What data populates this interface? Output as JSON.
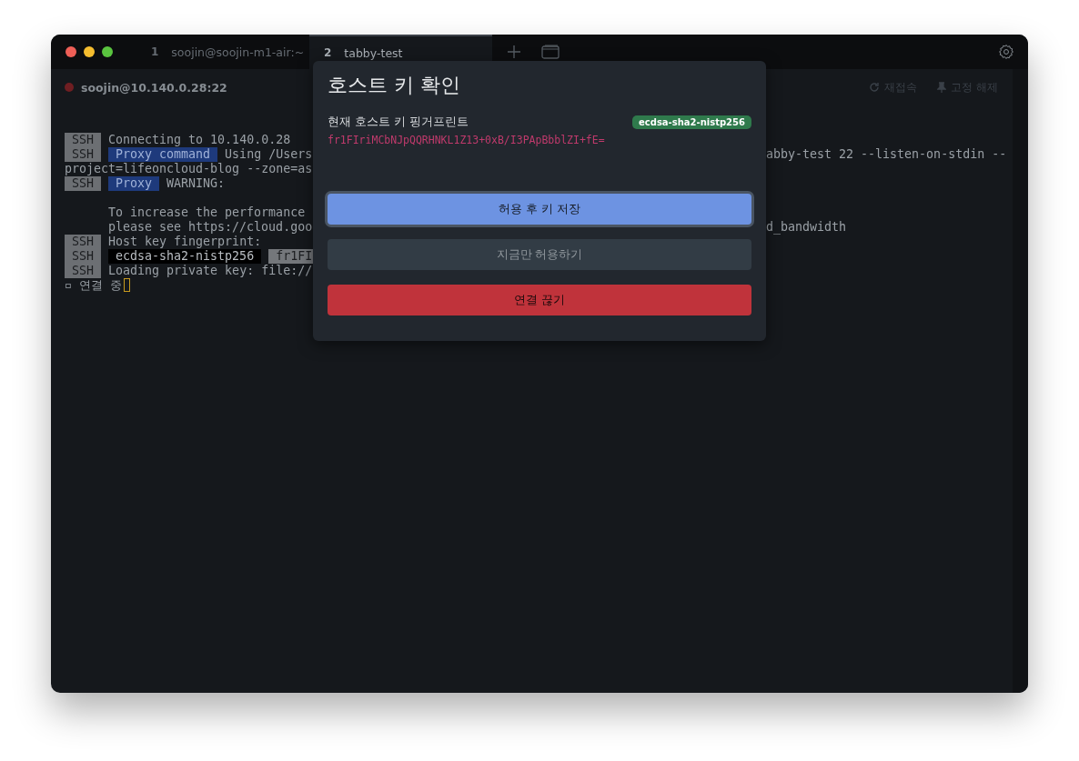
{
  "tabs": [
    {
      "number": "1",
      "label": "soojin@soojin-m1-air:~",
      "selected": false
    },
    {
      "number": "2",
      "label": "tabby-test",
      "selected": true
    }
  ],
  "header": {
    "connection": "soojin@10.140.0.28:22",
    "connected": false,
    "actions": [
      {
        "kind": "reconnect",
        "label": "재접속"
      },
      {
        "kind": "unpin",
        "label": "고정 해제"
      }
    ]
  },
  "terminal": {
    "lines": [
      {
        "kind": "ssh",
        "tag": "SSH",
        "text": "Connecting to 10.140.0.28"
      },
      {
        "kind": "ssh",
        "tag": "SSH",
        "chips": [
          {
            "text": "Proxy command",
            "kind": "blue"
          }
        ],
        "text": "Using /Users",
        "right": "abby-test 22 --listen-on-stdin --"
      },
      {
        "kind": "plain",
        "text": "project=lifeoncloud-blog --zone=as"
      },
      {
        "kind": "ssh",
        "tag": "SSH",
        "chips": [
          {
            "text": "Proxy",
            "kind": "blue"
          }
        ],
        "text": "WARNING:"
      },
      {
        "kind": "blank"
      },
      {
        "kind": "indent",
        "text": "To increase the performance"
      },
      {
        "kind": "indent",
        "text": "please see https://cloud.goo",
        "right": "d_bandwidth"
      },
      {
        "kind": "ssh",
        "tag": "SSH",
        "text": "Host key fingerprint:"
      },
      {
        "kind": "ssh",
        "tag": "SSH",
        "chips": [
          {
            "text": "ecdsa-sha2-nistp256",
            "kind": "black"
          },
          {
            "text": "fr1FI",
            "kind": "grey"
          }
        ]
      },
      {
        "kind": "ssh",
        "tag": "SSH",
        "text": "Loading private key: file://"
      }
    ],
    "status": "▫ 연결 중"
  },
  "dialog": {
    "title": "호스트 키 확인",
    "label": "현재 호스트 키 핑거프린트",
    "key_type": "ecdsa-sha2-nistp256",
    "fingerprint": "fr1FIriMCbNJpQQRHNKL1Z13+0xB/I3PApBbblZI+fE=",
    "buttons": [
      {
        "label": "허용 후 키 저장",
        "kind": "primary",
        "focused": true
      },
      {
        "label": "지금만 허용하기",
        "kind": "secondary",
        "focused": false
      },
      {
        "label": "연결 끊기",
        "kind": "danger",
        "focused": false
      }
    ]
  }
}
